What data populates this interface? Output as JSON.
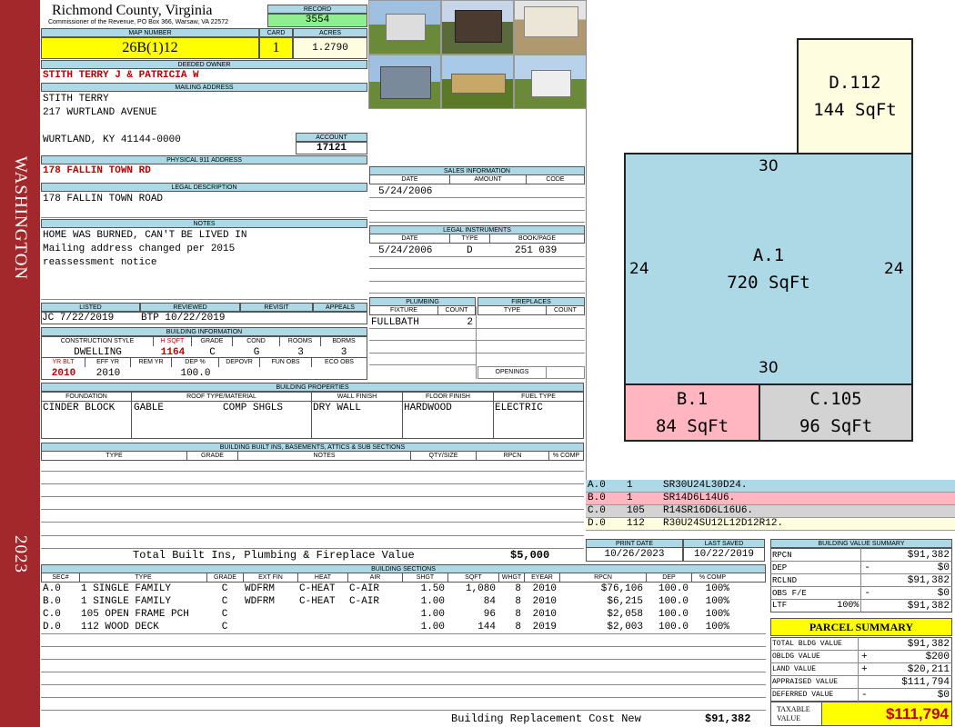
{
  "sidebar": {
    "county_name": "WASHINGTON",
    "year": "2023"
  },
  "header": {
    "title": "Richmond County, Virginia",
    "subtitle": "Commissioner of the Revenue, PO Box 366, Warsaw, VA 22572"
  },
  "record": {
    "label": "RECORD",
    "value": "3554"
  },
  "map": {
    "label": "MAP NUMBER",
    "value": "26B(1)12"
  },
  "card": {
    "label": "CARD",
    "value": "1"
  },
  "acres": {
    "label": "ACRES",
    "value": "1.2790"
  },
  "owner": {
    "label": "DEEDED OWNER",
    "value": "STITH TERRY J & PATRICIA W"
  },
  "mailing": {
    "label": "MAILING ADDRESS",
    "line1": "STITH TERRY",
    "line2": "217 WURTLAND AVENUE",
    "line3": "WURTLAND, KY 41144-0000"
  },
  "account": {
    "label": "ACCOUNT",
    "value": "17121"
  },
  "physical": {
    "label": "PHYSICAL 911 ADDRESS",
    "value": "178 FALLIN TOWN RD"
  },
  "legal": {
    "label": "LEGAL DESCRIPTION",
    "value": "178 FALLIN TOWN ROAD"
  },
  "notes": {
    "label": "NOTES",
    "line1": "HOME WAS BURNED, CAN'T BE LIVED IN",
    "line2": "Mailing address changed per 2015",
    "line3": "reassessment notice"
  },
  "listed": {
    "label": "LISTED",
    "value": "JC    7/22/2019"
  },
  "reviewed": {
    "label": "REVIEWED",
    "value": "BTP  10/22/2019"
  },
  "revisit": {
    "label": "REVISIT",
    "value": ""
  },
  "appeals": {
    "label": "APPEALS",
    "value": ""
  },
  "building_info": {
    "label": "BUILDING INFORMATION",
    "h1": "CONSTRUCTION STYLE",
    "h2": "H SQFT",
    "h3": "GRADE",
    "h4": "COND",
    "h5": "ROOMS",
    "h6": "BDRMS",
    "v1": "DWELLING",
    "v2": "1164",
    "v3": "C",
    "v4": "G",
    "v5": "3",
    "v6": "3",
    "h7": "YR BLT",
    "h8": "EFF YR",
    "h9": "REM YR",
    "h10": "DEP %",
    "h11": "DEPOVR",
    "h12": "FUN OBS",
    "h13": "ECO OBS",
    "v7": "2010",
    "v8": "2010",
    "v9": "",
    "v10": "100.0",
    "v11": "",
    "v12": "",
    "v13": ""
  },
  "sales": {
    "label": "SALES INFORMATION",
    "h1": "DATE",
    "h2": "AMOUNT",
    "h3": "CODE",
    "date": "5/24/2006",
    "amount": "",
    "code": ""
  },
  "legal_instr": {
    "label": "LEGAL INSTRUMENTS",
    "h1": "DATE",
    "h2": "TYPE",
    "h3": "BOOK/PAGE",
    "date": "5/24/2006",
    "type": "D",
    "book": "251 039"
  },
  "plumbing": {
    "label": "PLUMBING",
    "h1": "FIXTURE",
    "h2": "COUNT",
    "fixture": "FULLBATH",
    "count": "2"
  },
  "fireplaces": {
    "label": "FIREPLACES",
    "h1": "TYPE",
    "h2": "COUNT",
    "openings": "OPENINGS"
  },
  "props": {
    "label": "BUILDING PROPERTIES",
    "h1": "FOUNDATION",
    "h2": "ROOF TYPE/MATERIAL",
    "h3": "WALL FINISH",
    "h4": "FLOOR FINISH",
    "h5": "FUEL TYPE",
    "foundation": "CINDER BLOCK",
    "roof_type": "GABLE",
    "roof_mat": "COMP SHGLS",
    "wall": "DRY WALL",
    "floor": "HARDWOOD",
    "fuel": "ELECTRIC"
  },
  "builtins": {
    "label": "BUILDING BUILT INS, BASEMENTS, ATTICS & SUB SECTIONS",
    "h1": "TYPE",
    "h2": "GRADE",
    "h3": "NOTES",
    "h4": "QTY/SIZE",
    "h5": "RPCN",
    "h6": "% COMP",
    "total_label": "Total Built Ins, Plumbing & Fireplace Value",
    "total_value": "$5,000"
  },
  "dates": {
    "print_label": "PRINT DATE",
    "print": "10/26/2023",
    "saved_label": "LAST SAVED",
    "saved": "10/22/2019"
  },
  "sections": {
    "label": "BUILDING SECTIONS",
    "headers": [
      "SEC#",
      "TYPE",
      "GRADE",
      "EXT FIN",
      "HEAT",
      "AIR",
      "SHGT",
      "SQFT",
      "WHGT",
      "EYEAR",
      "RPCN",
      "DEP",
      "% COMP"
    ],
    "rows": [
      {
        "sec": "A.0",
        "type": "1 SINGLE FAMILY",
        "grade": "C",
        "ext": "WDFRM",
        "heat": "C-HEAT",
        "air": "C-AIR",
        "shgt": "1.50",
        "sqft": "1,080",
        "whgt": "8",
        "eyear": "2010",
        "rpcn": "$76,106",
        "dep": "100.0",
        "comp": "100%"
      },
      {
        "sec": "B.0",
        "type": "1 SINGLE FAMILY",
        "grade": "C",
        "ext": "WDFRM",
        "heat": "C-HEAT",
        "air": "C-AIR",
        "shgt": "1.00",
        "sqft": "84",
        "whgt": "8",
        "eyear": "2010",
        "rpcn": "$6,215",
        "dep": "100.0",
        "comp": "100%"
      },
      {
        "sec": "C.0",
        "type": "105 OPEN FRAME PCH",
        "grade": "C",
        "ext": "",
        "heat": "",
        "air": "",
        "shgt": "1.00",
        "sqft": "96",
        "whgt": "8",
        "eyear": "2010",
        "rpcn": "$2,058",
        "dep": "100.0",
        "comp": "100%"
      },
      {
        "sec": "D.0",
        "type": "112 WOOD DECK",
        "grade": "C",
        "ext": "",
        "heat": "",
        "air": "",
        "shgt": "1.00",
        "sqft": "144",
        "whgt": "8",
        "eyear": "2019",
        "rpcn": "$2,003",
        "dep": "100.0",
        "comp": "100%"
      }
    ],
    "brcn_label": "Building Replacement Cost New",
    "brcn_value": "$91,382"
  },
  "sketch": {
    "a_label": "A.1",
    "a_area": "720 SqFt",
    "b_label": "B.1",
    "b_area": "84 SqFt",
    "c_label": "C.105",
    "c_area": "96 SqFt",
    "d_label": "D.112",
    "d_area": "144 SqFt",
    "dim_top": "30",
    "dim_bottom": "30",
    "dim_left": "24",
    "dim_right": "24"
  },
  "legend": [
    {
      "sec": "A.0",
      "num": "1",
      "code": "SR30U24L30D24.",
      "color": "#add8e6"
    },
    {
      "sec": "B.0",
      "num": "1",
      "code": "SR14D6L14U6.",
      "color": "#ffb6c1"
    },
    {
      "sec": "C.0",
      "num": "105",
      "code": "R14SR16D6L16U6.",
      "color": "#d3d3d3"
    },
    {
      "sec": "D.0",
      "num": "112",
      "code": "R30U24SU12L12D12R12.",
      "color": "#fffde0"
    }
  ],
  "value_summary": {
    "label": "BUILDING VALUE SUMMARY",
    "rpcn_label": "RPCN",
    "rpcn": "$91,382",
    "dep_label": "DEP",
    "dep_sign": "-",
    "dep": "$0",
    "rclnd_label": "RCLND",
    "rclnd": "$91,382",
    "obs_label": "OBS F/E",
    "obs_sign": "-",
    "obs": "$0",
    "lt_label": "LTF",
    "lt_pct": "100%",
    "lt": "$91,382"
  },
  "parcel": {
    "label": "PARCEL SUMMARY",
    "bldg_label": "TOTAL BLDG VALUE",
    "bldg": "$91,382",
    "obldg_label": "OBLDG VALUE",
    "obldg_sign": "+",
    "obldg": "$200",
    "land_label": "LAND VALUE",
    "land_sign": "+",
    "land": "$20,211",
    "appraised_label": "APPRAISED VALUE",
    "appraised": "$111,794",
    "deferred_label": "DEFERRED VALUE",
    "deferred_sign": "-",
    "deferred": "$0",
    "taxable_label1": "TAXABLE",
    "taxable_label2": "VALUE",
    "taxable": "$111,794"
  },
  "colors": {
    "header_bg": "#add8e6",
    "sidebar": "#a3282b",
    "yellow": "#ffff00",
    "green": "#90ee90",
    "red": "#c00000"
  }
}
